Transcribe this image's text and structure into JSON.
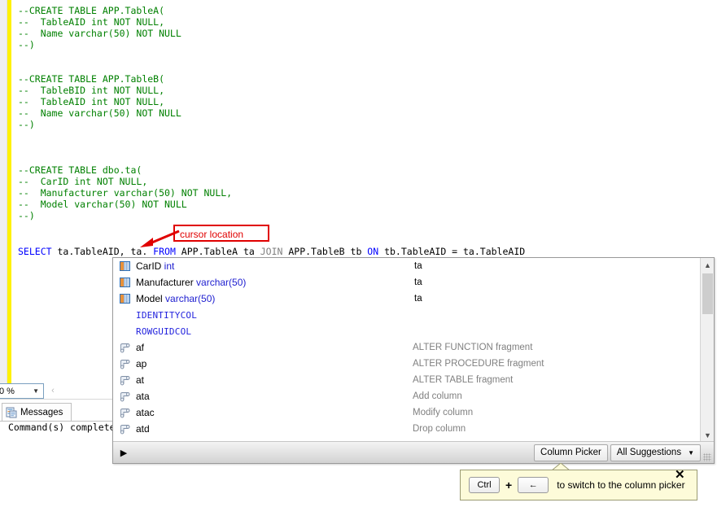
{
  "editor": {
    "lines": [
      {
        "t": "comment",
        "text": "--CREATE TABLE APP.TableA("
      },
      {
        "t": "comment",
        "text": "--  TableAID int NOT NULL,"
      },
      {
        "t": "comment",
        "text": "--  Name varchar(50) NOT NULL"
      },
      {
        "t": "comment",
        "text": "--)"
      },
      {
        "t": "blank",
        "text": ""
      },
      {
        "t": "blank",
        "text": ""
      },
      {
        "t": "comment",
        "text": "--CREATE TABLE APP.TableB("
      },
      {
        "t": "comment",
        "text": "--  TableBID int NOT NULL,"
      },
      {
        "t": "comment",
        "text": "--  TableAID int NOT NULL,"
      },
      {
        "t": "comment",
        "text": "--  Name varchar(50) NOT NULL"
      },
      {
        "t": "comment",
        "text": "--)"
      },
      {
        "t": "blank",
        "text": ""
      },
      {
        "t": "blank",
        "text": ""
      },
      {
        "t": "blank",
        "text": ""
      },
      {
        "t": "comment",
        "text": "--CREATE TABLE dbo.ta("
      },
      {
        "t": "comment",
        "text": "--  CarID int NOT NULL,"
      },
      {
        "t": "comment",
        "text": "--  Manufacturer varchar(50) NOT NULL,"
      },
      {
        "t": "comment",
        "text": "--  Model varchar(50) NOT NULL"
      },
      {
        "t": "comment",
        "text": "--)"
      },
      {
        "t": "blank",
        "text": ""
      },
      {
        "t": "blank",
        "text": ""
      },
      {
        "t": "blank",
        "text": ""
      }
    ],
    "query_line": {
      "select_kw": "SELECT",
      "cols": " ta.TableAID, ta. ",
      "from_kw": "FROM",
      "from_tbl": " APP.TableA ta ",
      "join_kw": "JOIN",
      "join_tbl": " APP.TableB tb ",
      "on_kw": "ON",
      "on_expr": " tb.TableAID = ta.TableAID"
    },
    "annotation": {
      "label": "cursor location"
    }
  },
  "results": {
    "zoom_value": "0 %",
    "messages_tab_label": "Messages",
    "messages_text": "Command(s) complete"
  },
  "intellisense": {
    "items": [
      {
        "icon": "column-icon",
        "name": "CarID",
        "type": " int",
        "source": "ta",
        "desc": ""
      },
      {
        "icon": "column-icon",
        "name": "Manufacturer",
        "type": " varchar(50)",
        "source": "ta",
        "desc": ""
      },
      {
        "icon": "column-icon",
        "name": "Model",
        "type": " varchar(50)",
        "source": "ta",
        "desc": ""
      },
      {
        "icon": "none",
        "name": "IDENTITYCOL",
        "type": "",
        "source": "",
        "desc": ""
      },
      {
        "icon": "none",
        "name": "ROWGUIDCOL",
        "type": "",
        "source": "",
        "desc": ""
      },
      {
        "icon": "snippet-icon",
        "name": "af",
        "type": "",
        "source": "",
        "desc": "ALTER FUNCTION fragment"
      },
      {
        "icon": "snippet-icon",
        "name": "ap",
        "type": "",
        "source": "",
        "desc": "ALTER PROCEDURE fragment"
      },
      {
        "icon": "snippet-icon",
        "name": "at",
        "type": "",
        "source": "",
        "desc": "ALTER TABLE fragment"
      },
      {
        "icon": "snippet-icon",
        "name": "ata",
        "type": "",
        "source": "",
        "desc": "Add column"
      },
      {
        "icon": "snippet-icon",
        "name": "atac",
        "type": "",
        "source": "",
        "desc": "Modify column"
      },
      {
        "icon": "snippet-icon",
        "name": "atd",
        "type": "",
        "source": "",
        "desc": "Drop column"
      }
    ],
    "toolbar": {
      "expander_glyph": "▶",
      "column_picker_label": "Column Picker",
      "suggestions_label": "All Suggestions",
      "suggestions_caret": "▼"
    },
    "scrollbar": {
      "up_glyph": "▲",
      "down_glyph": "▼"
    }
  },
  "tooltip": {
    "key_ctrl": "Ctrl",
    "plus": "+",
    "key_arrow": "←",
    "text": "to switch to the column picker",
    "close_glyph": "✕"
  },
  "colors": {
    "comment_green": "#008000",
    "keyword_blue": "#0000ff",
    "annotation_red": "#e00000",
    "changebar_yellow": "#fff100",
    "tooltip_bg": "#fdfbd9"
  }
}
